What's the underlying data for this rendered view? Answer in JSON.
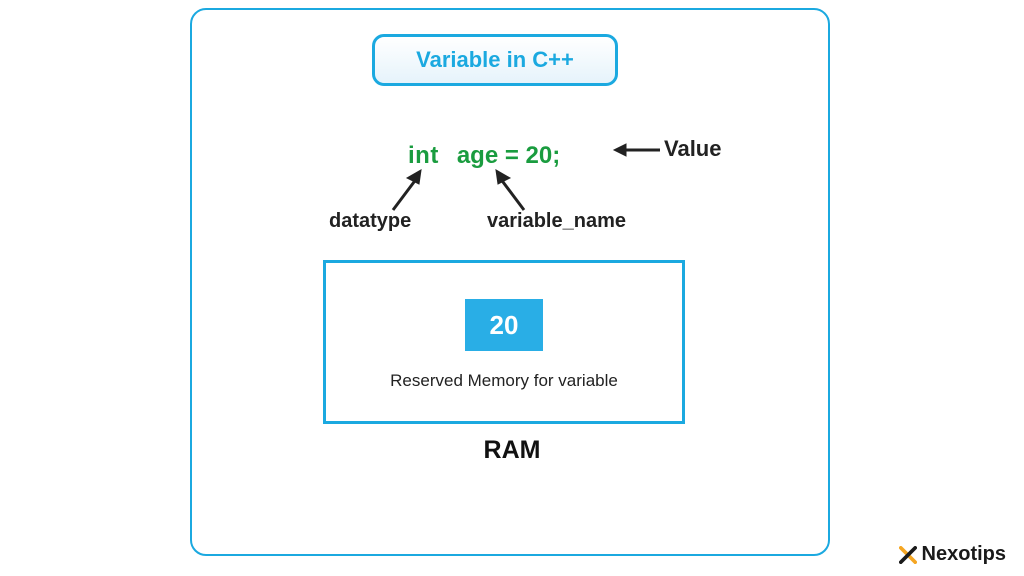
{
  "title": "Variable in C++",
  "code": {
    "datatype": "int",
    "varname": "age",
    "equals": "=",
    "value": "20",
    "semicolon": ";"
  },
  "labels": {
    "value": "Value",
    "datatype": "datatype",
    "varname": "variable_name"
  },
  "ram": {
    "stored_value": "20",
    "caption": "Reserved Memory for variable",
    "label": "RAM"
  },
  "brand": "Nexotips"
}
